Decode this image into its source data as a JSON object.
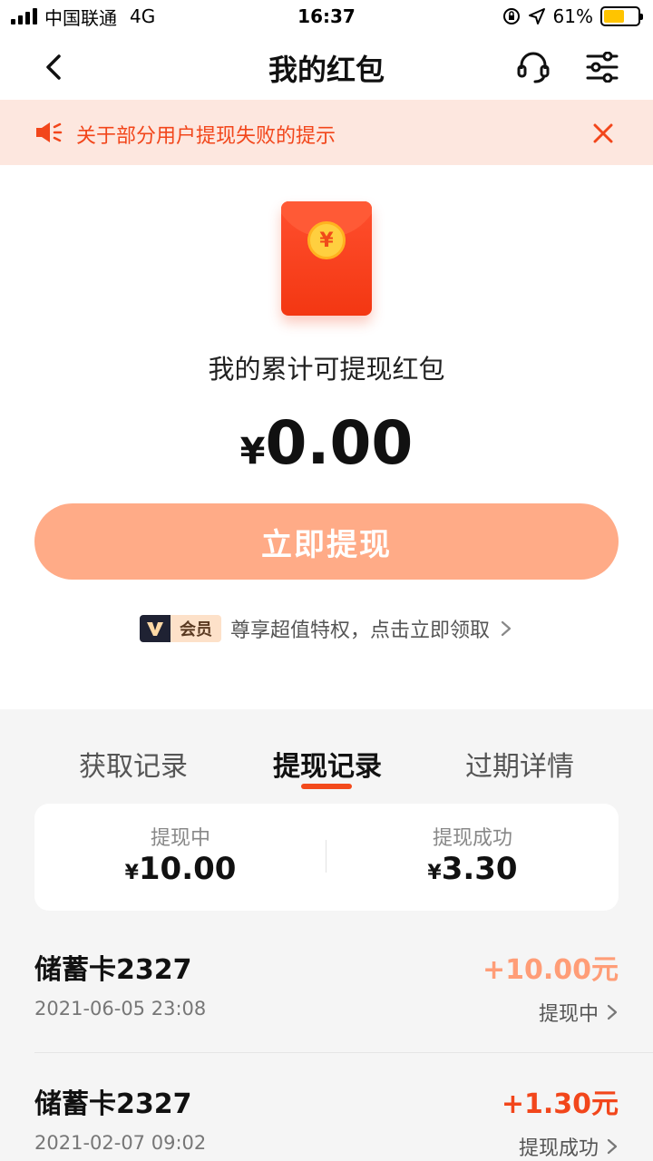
{
  "status_bar": {
    "carrier": "中国联通",
    "network": "4G",
    "time": "16:37",
    "battery": "61%",
    "battery_level": 0.61
  },
  "nav": {
    "title": "我的红包",
    "icons": [
      "back-icon",
      "customer-service-icon",
      "settings-icon"
    ]
  },
  "notice": {
    "text": "关于部分用户提现失败的提示",
    "color": "#f2461b",
    "background": "#fde7df"
  },
  "hero": {
    "label": "我的累计可提现红包",
    "currency": "¥",
    "amount": "0.00",
    "button_label": "立即提现",
    "button_color": "#ffab87",
    "envelope_symbol": "¥"
  },
  "vip": {
    "badge": "会员",
    "text": "尊享超值特权，点击立即领取"
  },
  "tabs": [
    {
      "label": "获取记录",
      "active": false
    },
    {
      "label": "提现记录",
      "active": true
    },
    {
      "label": "过期详情",
      "active": false
    }
  ],
  "summary": {
    "pending": {
      "label": "提现中",
      "currency": "¥",
      "value": "10.00"
    },
    "success": {
      "label": "提现成功",
      "currency": "¥",
      "value": "3.30"
    }
  },
  "records": [
    {
      "title": "储蓄卡2327",
      "date": "2021-06-05 23:08",
      "amount": "+10.00元",
      "status": "提现中",
      "amount_color": "#ff9d77"
    },
    {
      "title": "储蓄卡2327",
      "date": "2021-02-07 09:02",
      "amount": "+1.30元",
      "status": "提现成功",
      "amount_color": "#f2461b"
    }
  ],
  "accent_color": "#f34a1c"
}
